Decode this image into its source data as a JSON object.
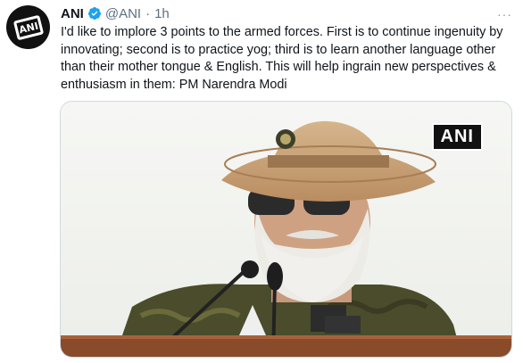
{
  "tweet": {
    "author_name": "ANI",
    "handle": "@ANI",
    "separator": "·",
    "time": "1h",
    "more_label": "···",
    "avatar_text": "ANI",
    "text": "I'd like to implore 3 points to the armed forces. First is to continue ingenuity by innovating; second is to practice yog; third is to learn another language other than their mother tongue & English. This will help ingrain new perspectives & enthusiasm in them: PM Narendra Modi",
    "media": {
      "watermark": "ANI"
    }
  },
  "colors": {
    "verified_blue": "#1da1f2",
    "secondary_text": "#5b7083",
    "hat": "#c9a27a"
  },
  "icons": {
    "verified": "verified-badge-icon",
    "more": "more-icon"
  }
}
